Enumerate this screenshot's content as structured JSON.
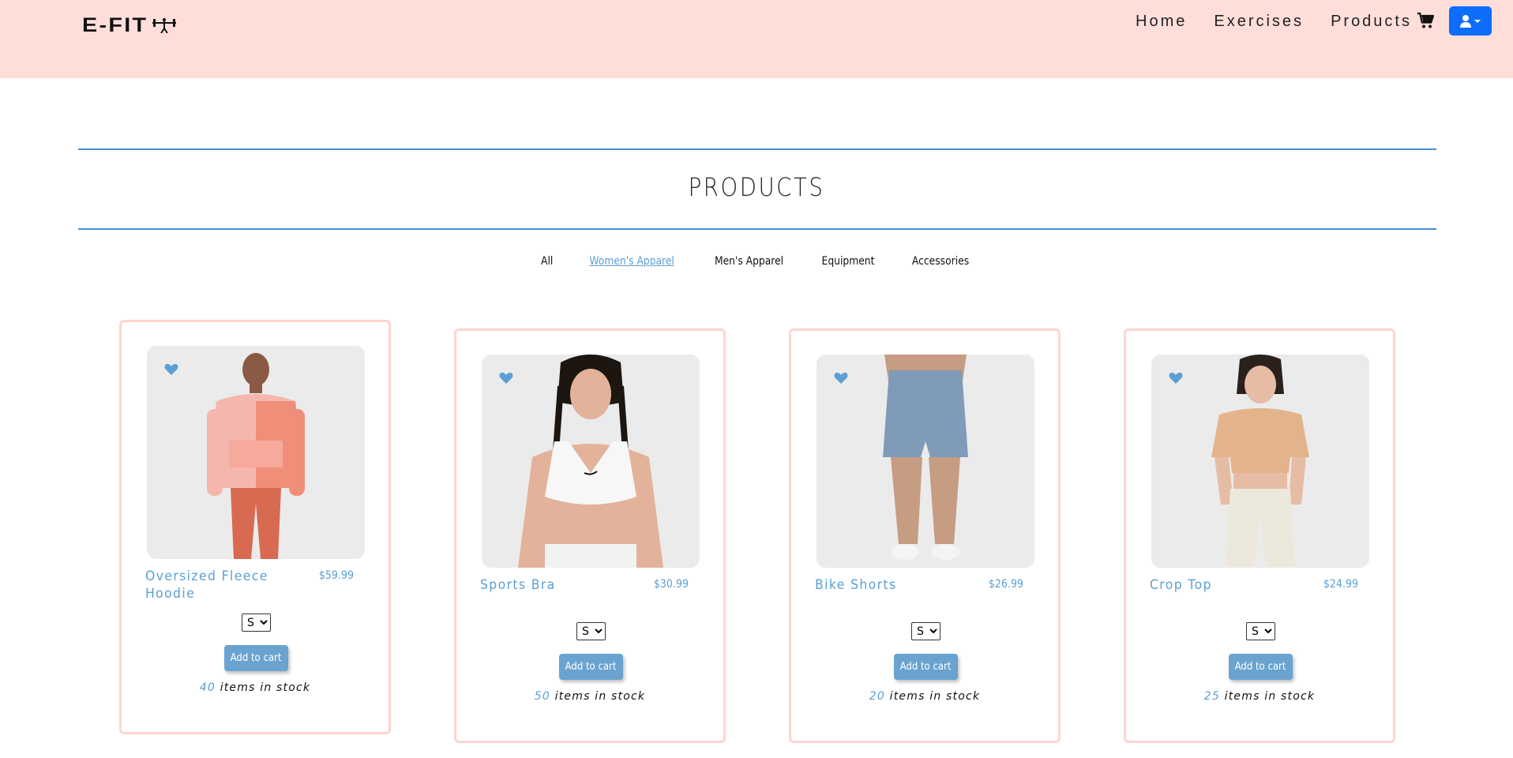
{
  "brand": {
    "logo_text": "E-FIT"
  },
  "nav": {
    "links": [
      {
        "label": "Home"
      },
      {
        "label": "Exercises"
      },
      {
        "label": "Products"
      }
    ]
  },
  "page": {
    "title": "PRODUCTS"
  },
  "filters": {
    "items": [
      {
        "label": "All"
      },
      {
        "label": "Women's Apparel"
      },
      {
        "label": "Men's Apparel"
      },
      {
        "label": "Equipment"
      },
      {
        "label": "Accessories"
      }
    ],
    "active": "Women's Apparel"
  },
  "products": [
    {
      "name": "Oversized Fleece Hoodie",
      "price": "$59.99",
      "size": "S",
      "add_label": "Add to cart",
      "stock": "40",
      "stock_suffix": "items in stock"
    },
    {
      "name": "Sports Bra",
      "price": "$30.99",
      "size": "S",
      "add_label": "Add to cart",
      "stock": "50",
      "stock_suffix": "items in stock"
    },
    {
      "name": "Bike Shorts",
      "price": "$26.99",
      "size": "S",
      "add_label": "Add to cart",
      "stock": "20",
      "stock_suffix": "items in stock"
    },
    {
      "name": "Crop Top",
      "price": "$24.99",
      "size": "S",
      "add_label": "Add to cart",
      "stock": "25",
      "stock_suffix": "items in stock"
    }
  ],
  "colors": {
    "header_bg": "#ffdeda",
    "accent_blue": "#5b9fd6",
    "user_button": "#0d6efd",
    "card_border": "#ffd5cf"
  },
  "icons": [
    "dumbbell-icon",
    "cart-icon",
    "user-icon",
    "caret-down-icon",
    "heart-icon"
  ]
}
